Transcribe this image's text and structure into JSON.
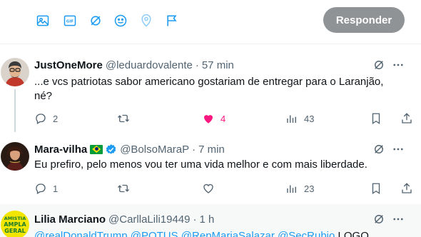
{
  "compose": {
    "tools": [
      "image-icon",
      "gif-icon",
      "grok-icon",
      "emoji-icon",
      "location-icon",
      "schedule-flag-icon"
    ],
    "reply_label": "Responder"
  },
  "tweets": [
    {
      "name": "JustOneMore",
      "handle": "@leduardovalente",
      "time": "57 min",
      "text_line1": "...e vcs patriotas sabor americano gostariam de entregar para o Laranjão,",
      "text_line2": "né?",
      "replies": "2",
      "retweets": "",
      "likes": "4",
      "views": "43",
      "liked": true
    },
    {
      "name": "Mara-vilha",
      "flag": "brazil-flag-icon",
      "verified": true,
      "handle": "@BolsoMaraP",
      "time": "7 min",
      "text_line1": "Eu prefiro, pelo menos vou ter uma vida melhor e com mais liberdade.",
      "replies": "1",
      "retweets": "",
      "likes": "",
      "views": "23",
      "liked": false
    },
    {
      "name": "Lilia Marciano",
      "handle": "@CarllaLili19449",
      "time": "1 h",
      "avatar_text": [
        "AMISTIA",
        "AMPLA",
        "GERAL"
      ],
      "mentions_line": "@realDonaldTrump @POTUS @RepMariaSalazar @SecRubio",
      "tail_text": " LOGO"
    }
  ],
  "colors": {
    "accent": "#1d9bf0",
    "like": "#f91880",
    "muted": "#536471",
    "reply_button": "#8f9396"
  },
  "dot": "·"
}
